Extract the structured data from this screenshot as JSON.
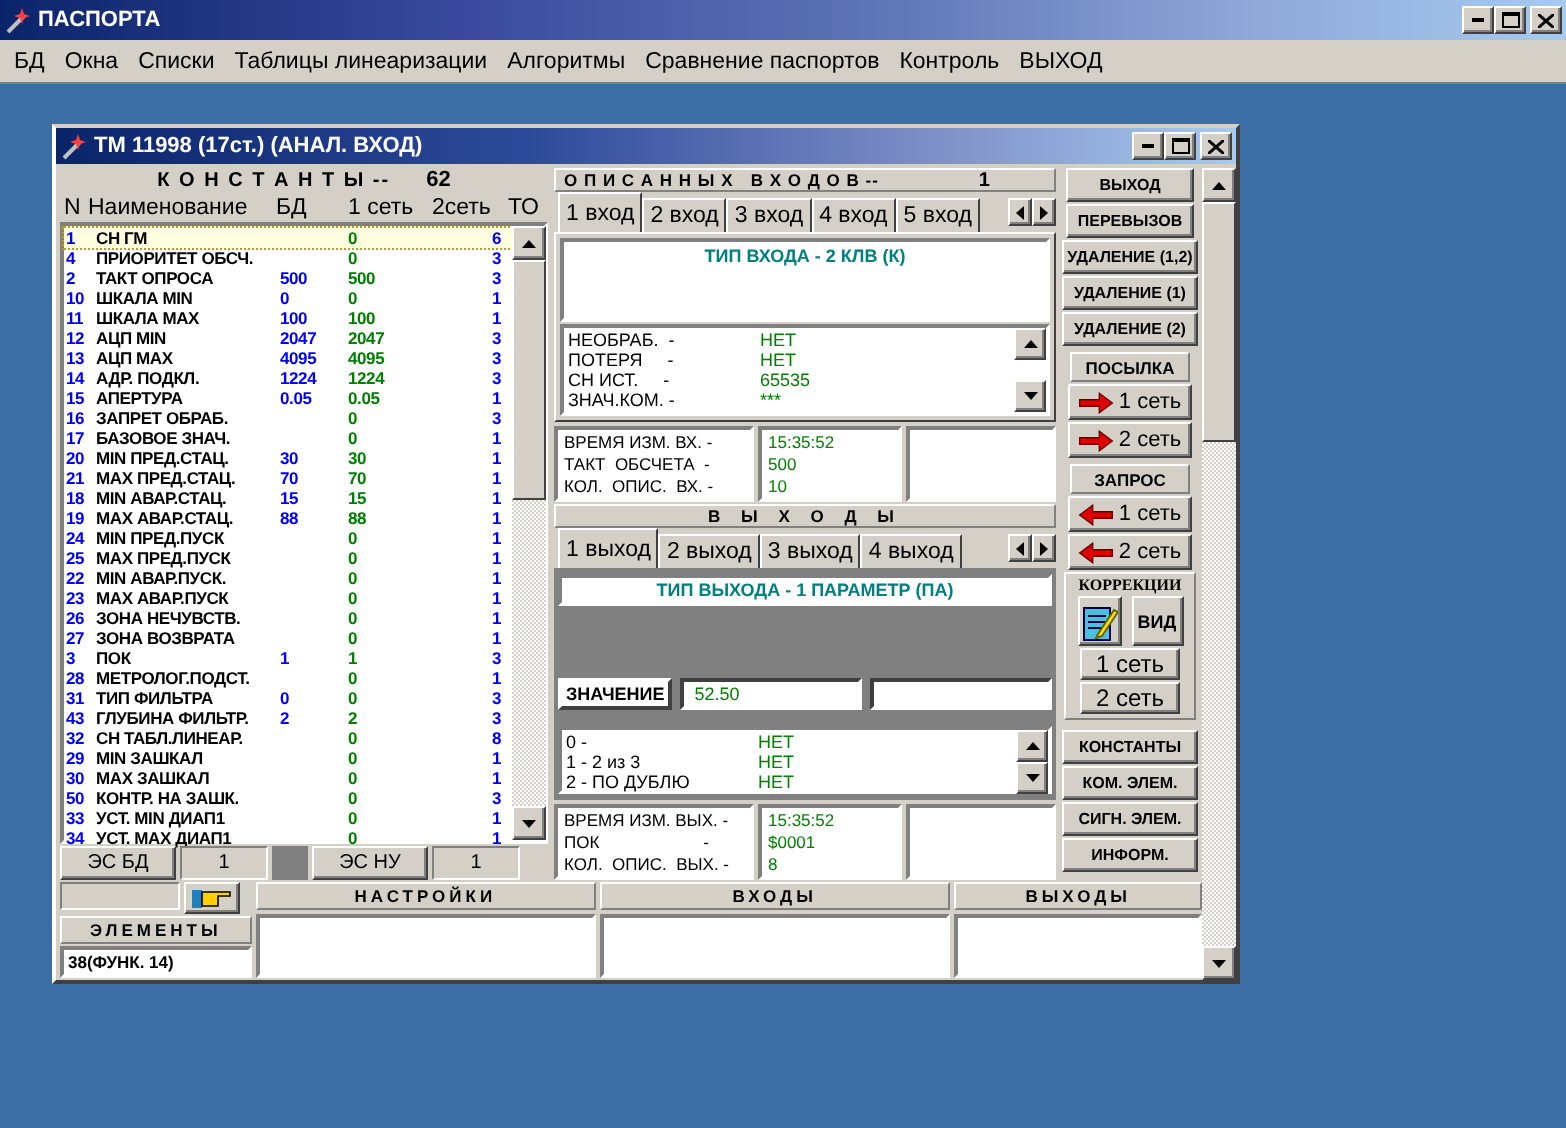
{
  "app": {
    "title": "ПАСПОРТА"
  },
  "menu": [
    "БД",
    "Окна",
    "Списки",
    "Таблицы линеаризации",
    "Алгоритмы",
    "Сравнение паспортов",
    "Контроль",
    "ВЫХОД"
  ],
  "child": {
    "title": "ТМ 11998 (17ст.) (АНАЛ. ВХОД)"
  },
  "constants": {
    "header": "К О Н С Т А Н Т Ы --",
    "count": "62",
    "columns": [
      "N",
      "Наименование",
      "БД",
      "1 сеть",
      "2сеть",
      "ТО"
    ],
    "rows": [
      {
        "n": "1",
        "name": "СН ГМ",
        "net1": "0",
        "to": "6",
        "selected": true
      },
      {
        "n": "4",
        "name": "ПРИОРИТЕТ ОБСЧ.",
        "net1": "0",
        "to": "3",
        "selected": false
      },
      {
        "n": "2",
        "name": "ТАКТ ОПРОСА",
        "bd": "500",
        "net1": "500",
        "to": "3",
        "selected": false
      },
      {
        "n": "10",
        "name": "ШКАЛА MIN",
        "bd": "0",
        "net1": "0",
        "to": "1",
        "selected": false
      },
      {
        "n": "11",
        "name": "ШКАЛА MAX",
        "bd": "100",
        "net1": "100",
        "to": "1",
        "selected": false
      },
      {
        "n": "12",
        "name": "АЦП MIN",
        "bd": "2047",
        "net1": "2047",
        "to": "3",
        "selected": false
      },
      {
        "n": "13",
        "name": "АЦП MAX",
        "bd": "4095",
        "net1": "4095",
        "to": "3",
        "selected": false
      },
      {
        "n": "14",
        "name": "АДР. ПОДКЛ.",
        "bd": "1224",
        "net1": "1224",
        "to": "3",
        "selected": false
      },
      {
        "n": "15",
        "name": "АПЕРТУРА",
        "bd": "0.05",
        "net1": "0.05",
        "to": "1",
        "selected": false
      },
      {
        "n": "16",
        "name": "ЗАПРЕТ ОБРАБ.",
        "net1": "0",
        "to": "3",
        "selected": false
      },
      {
        "n": "17",
        "name": "БАЗОВОЕ ЗНАЧ.",
        "net1": "0",
        "to": "1",
        "selected": false
      },
      {
        "n": "20",
        "name": "MIN ПРЕД.СТАЦ.",
        "bd": "30",
        "net1": "30",
        "to": "1",
        "selected": false
      },
      {
        "n": "21",
        "name": "MAX ПРЕД.СТАЦ.",
        "bd": "70",
        "net1": "70",
        "to": "1",
        "selected": false
      },
      {
        "n": "18",
        "name": "MIN АВАР.СТАЦ.",
        "bd": "15",
        "net1": "15",
        "to": "1",
        "selected": false
      },
      {
        "n": "19",
        "name": "MAX АВАР.СТАЦ.",
        "bd": "88",
        "net1": "88",
        "to": "1",
        "selected": false
      },
      {
        "n": "24",
        "name": "MIN ПРЕД.ПУСК",
        "net1": "0",
        "to": "1",
        "selected": false
      },
      {
        "n": "25",
        "name": "MAX ПРЕД.ПУСК",
        "net1": "0",
        "to": "1",
        "selected": false
      },
      {
        "n": "22",
        "name": "MIN АВАР.ПУСК.",
        "net1": "0",
        "to": "1",
        "selected": false
      },
      {
        "n": "23",
        "name": "MAX АВАР.ПУСК",
        "net1": "0",
        "to": "1",
        "selected": false
      },
      {
        "n": "26",
        "name": "ЗОНА НЕЧУВСТВ.",
        "net1": "0",
        "to": "1",
        "selected": false
      },
      {
        "n": "27",
        "name": "ЗОНА ВОЗВРАТА",
        "net1": "0",
        "to": "1",
        "selected": false
      },
      {
        "n": "3",
        "name": "ПОК",
        "bd": "1",
        "net1": "1",
        "to": "3",
        "selected": false
      },
      {
        "n": "28",
        "name": "МЕТРОЛОГ.ПОДСТ.",
        "net1": "0",
        "to": "1",
        "selected": false
      },
      {
        "n": "31",
        "name": "ТИП ФИЛЬТРА",
        "bd": "0",
        "net1": "0",
        "to": "3",
        "selected": false
      },
      {
        "n": "43",
        "name": "ГЛУБИНА ФИЛЬТР.",
        "bd": "2",
        "net1": "2",
        "to": "3",
        "selected": false
      },
      {
        "n": "32",
        "name": "СН ТАБЛ.ЛИНЕАР.",
        "net1": "0",
        "to": "8",
        "selected": false
      },
      {
        "n": "29",
        "name": "MIN ЗАШКАЛ",
        "net1": "0",
        "to": "1",
        "selected": false
      },
      {
        "n": "30",
        "name": "MAX ЗАШКАЛ",
        "net1": "0",
        "to": "1",
        "selected": false
      },
      {
        "n": "50",
        "name": "КОНТР. НА ЗАШК.",
        "net1": "0",
        "to": "3",
        "selected": false
      },
      {
        "n": "33",
        "name": "УСТ. MIN ДИАП1",
        "net1": "0",
        "to": "1",
        "selected": false
      },
      {
        "n": "34",
        "name": "УСТ. MAX ДИАП1",
        "net1": "0",
        "to": "1",
        "selected": false
      }
    ],
    "footer": [
      {
        "kind": "button",
        "text": "ЭС БД"
      },
      {
        "kind": "field",
        "text": "1"
      },
      {
        "kind": "button",
        "text": "ЭС НУ"
      },
      {
        "kind": "field",
        "text": "1"
      }
    ]
  },
  "inputs": {
    "header": "О П И С А Н Н Ы Х   В Х О Д О В --",
    "count": "1",
    "tabs": [
      {
        "label": "1 вход",
        "selected": true
      },
      {
        "label": "2 вход",
        "selected": false
      },
      {
        "label": "3 вход",
        "selected": false
      },
      {
        "label": "4 вход",
        "selected": false
      },
      {
        "label": "5 вход",
        "selected": false
      }
    ],
    "type": "ТИП ВХОДА - 2 КЛВ (К)",
    "flags": [
      {
        "label": "НЕОБРАБ.  -",
        "value": "НЕТ"
      },
      {
        "label": "ПОТЕРЯ     -",
        "value": "НЕТ"
      },
      {
        "label": "СН ИСТ.     -",
        "value": "65535"
      },
      {
        "label": "ЗНАЧ.КОМ. -",
        "value": "***"
      }
    ],
    "info_labels": [
      "ВРЕМЯ ИЗМ. ВХ. -",
      "ТАКТ  ОБСЧЕТА  -",
      "КОЛ.  ОПИС.  ВХ. -"
    ],
    "info_values": [
      "15:35:52",
      "500",
      "10"
    ]
  },
  "outputs": {
    "header": "В Ы Х О Д Ы",
    "tabs": [
      {
        "label": "1 выход",
        "selected": true
      },
      {
        "label": "2 выход",
        "selected": false
      },
      {
        "label": "3 выход",
        "selected": false
      },
      {
        "label": "4 выход",
        "selected": false
      }
    ],
    "type": "ТИП ВЫХОДА - 1 ПАРАМЕТР  (ПА)",
    "value_label": "ЗНАЧЕНИЕ",
    "value": "52.50",
    "flags": [
      {
        "label": "0 -",
        "value": "НЕТ"
      },
      {
        "label": "1 - 2 из 3",
        "value": "НЕТ"
      },
      {
        "label": "2 - ПО ДУБЛЮ",
        "value": "НЕТ"
      }
    ],
    "info_labels": [
      "ВРЕМЯ ИЗМ. ВЫХ. -",
      "ПОК                      -",
      "КОЛ.  ОПИС.  ВЫХ. -"
    ],
    "info_values": [
      "15:35:52",
      "$0001",
      "8"
    ]
  },
  "actions": [
    {
      "kind": "button",
      "text": "ВЫХОД"
    },
    {
      "kind": "button",
      "text": "ПЕРЕВЫЗОВ"
    },
    {
      "kind": "button",
      "text": "УДАЛЕНИЕ (1,2)"
    },
    {
      "kind": "button",
      "text": "УДАЛЕНИЕ (1)"
    },
    {
      "kind": "button",
      "text": "УДАЛЕНИЕ (2)"
    },
    {
      "kind": "caption",
      "text": "ПОСЫЛКА"
    },
    {
      "kind": "send",
      "text": "1 сеть"
    },
    {
      "kind": "send",
      "text": "2 сеть"
    },
    {
      "kind": "caption",
      "text": "ЗАПРОС"
    },
    {
      "kind": "request",
      "text": "1 сеть"
    },
    {
      "kind": "request",
      "text": "2 сеть"
    }
  ],
  "corrections": {
    "title": "КОРРЕКЦИИ",
    "view": "ВИД",
    "buttons": [
      "1 сеть",
      "2 сеть"
    ]
  },
  "lists": [
    "КОНСТАНТЫ",
    "КОМ. ЭЛЕМ.",
    "СИГН. ЭЛЕМ.",
    "ИНФОРМ."
  ],
  "bottom": {
    "elements": "ЭЛЕМЕНТЫ",
    "element_text": "38(ФУНК. 14)",
    "sections": [
      "НАСТРОЙКИ",
      "ВХОДЫ",
      "ВЫХОДЫ"
    ]
  }
}
